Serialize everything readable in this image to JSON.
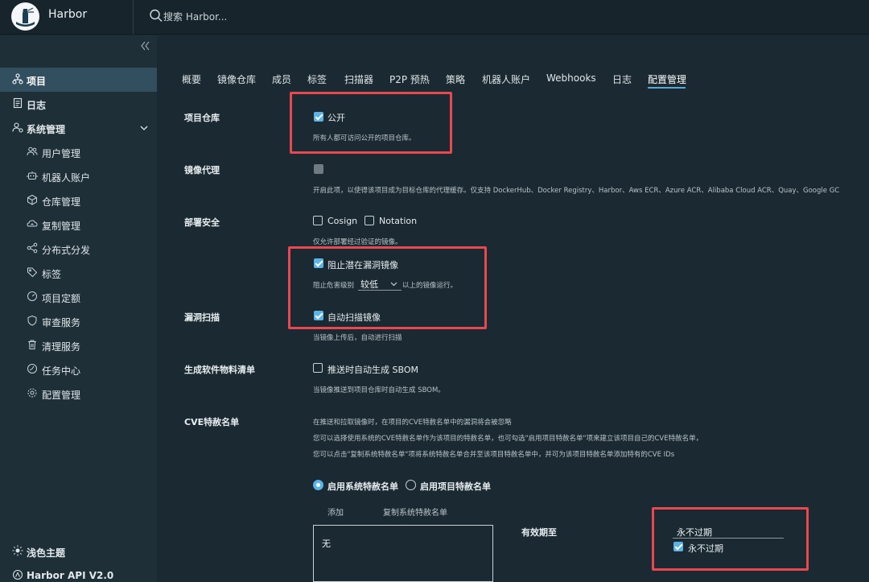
{
  "header": {
    "brand": "Harbor",
    "search_placeholder": "搜索 Harbor..."
  },
  "sidebar": {
    "top_items": [
      {
        "label": "项目",
        "icon": "projects-icon",
        "active": true
      },
      {
        "label": "日志",
        "icon": "logs-icon",
        "active": false
      },
      {
        "label": "系统管理",
        "icon": "admin-icon",
        "active": false
      }
    ],
    "sub_items": [
      {
        "label": "用户管理",
        "icon": "users-icon"
      },
      {
        "label": "机器人账户",
        "icon": "robot-icon"
      },
      {
        "label": "仓库管理",
        "icon": "registry-icon"
      },
      {
        "label": "复制管理",
        "icon": "replication-icon"
      },
      {
        "label": "分布式分发",
        "icon": "distribution-icon"
      },
      {
        "label": "标签",
        "icon": "tag-icon"
      },
      {
        "label": "项目定额",
        "icon": "quota-icon"
      },
      {
        "label": "审查服务",
        "icon": "shield-icon"
      },
      {
        "label": "清理服务",
        "icon": "trash-icon"
      },
      {
        "label": "任务中心",
        "icon": "dashboard-icon"
      },
      {
        "label": "配置管理",
        "icon": "gear-icon"
      }
    ],
    "theme_label": "浅色主题",
    "api_label": "Harbor API V2.0"
  },
  "tabs": [
    {
      "label": "概要"
    },
    {
      "label": "镜像仓库"
    },
    {
      "label": "成员"
    },
    {
      "label": "标签"
    },
    {
      "label": "扫描器"
    },
    {
      "label": "P2P 预热"
    },
    {
      "label": "策略"
    },
    {
      "label": "机器人账户"
    },
    {
      "label": "Webhooks"
    },
    {
      "label": "日志"
    },
    {
      "label": "配置管理",
      "active": true
    }
  ],
  "config": {
    "public": {
      "label": "项目仓库",
      "checkbox": "公开",
      "checked": true,
      "help": "所有人都可访问公开的项目仓库。"
    },
    "proxy": {
      "label": "镜像代理",
      "checked": false,
      "help": "开启此项，以使得该项目成为目标仓库的代理缓存。仅支持 DockerHub、Docker Registry、Harbor、Aws ECR、Azure ACR、Alibaba Cloud ACR、Quay、Google GC"
    },
    "deploy": {
      "label": "部署安全",
      "cosign": "Cosign",
      "notation": "Notation",
      "help": "仅允许部署经过验证的镜像。"
    },
    "prevent": {
      "checkbox": "阻止潜在漏洞镜像",
      "checked": true,
      "prefix": "阻止危害级别",
      "severity": "较低",
      "suffix": "以上的镜像运行。"
    },
    "scan": {
      "label": "漏洞扫描",
      "checkbox": "自动扫描镜像",
      "checked": true,
      "help": "当镜像上传后，自动进行扫描"
    },
    "sbom": {
      "label": "生成软件物料清单",
      "checkbox": "推送时自动生成 SBOM",
      "checked": false,
      "help": "当镜像推送到项目仓库时自动生成 SBOM。"
    },
    "cve": {
      "label": "CVE特赦名单",
      "help1": "在推送和拉取镜像时，在项目的CVE特赦名单中的漏洞将会被忽略",
      "help2": "您可以选择使用系统的CVE特赦名单作为该项目的特赦名单，也可勾选\"启用项目特赦名单\"项来建立该项目自己的CVE特赦名单，",
      "help3": "您可以点击\"复制系统特赦名单\"项将系统特赦名单合并至该项目特赦名单中，并可为该项目特赦名单添加特有的CVE IDs",
      "radio_system": "启用系统特赦名单",
      "radio_project": "启用项目特赦名单",
      "add": "添加",
      "copy": "复制系统特赦名单",
      "list_value": "无",
      "expiry_label": "有效期至",
      "expiry_value": "永不过期",
      "never_expire": "永不过期",
      "never_expire_checked": true
    }
  },
  "colors": {
    "accent": "#5ab5e6",
    "highlight": "#e8484f",
    "active_nav": "#324f60"
  }
}
